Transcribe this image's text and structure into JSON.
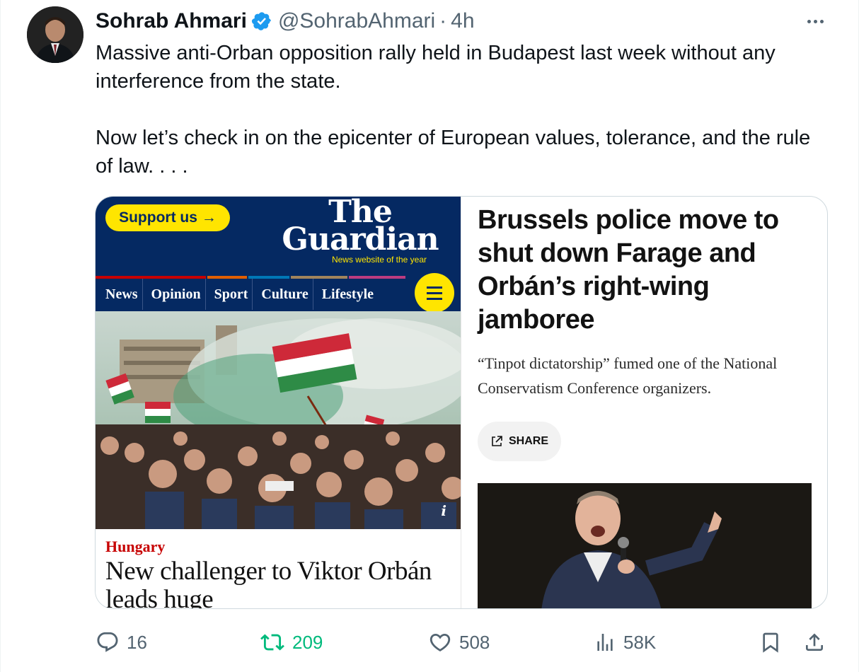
{
  "tweet": {
    "author_name": "Sohrab Ahmari",
    "handle": "@SohrabAhmari",
    "separator": "·",
    "time": "4h",
    "text_para1": "Massive anti-Orban opposition rally held in Budapest last week without any interference from the state.",
    "text_para2": "Now let’s check in on the epicenter of European values, tolerance, and the rule of law. . . ."
  },
  "image_left": {
    "support_label": "Support us",
    "support_arrow": "→",
    "logo_line1": "The",
    "logo_line2": "Guardian",
    "logo_tagline": "News website of the year",
    "nav": [
      "News",
      "Opinion",
      "Sport",
      "Culture",
      "Lifestyle"
    ],
    "photo_info": "i",
    "kicker": "Hungary",
    "headline": "New challenger to Viktor Orbán leads huge"
  },
  "image_right": {
    "headline": "Brussels police move to shut down Farage and Orbán’s right-wing jamboree",
    "standfirst": "“Tinpot dictatorship” fumed one of the National Conservatism Conference organizers.",
    "share_label": "SHARE"
  },
  "actions": {
    "replies": "16",
    "retweets": "209",
    "likes": "508",
    "views": "58K"
  },
  "colors": {
    "text_primary": "#0f1419",
    "text_secondary": "#536471",
    "verified_blue": "#1d9bf0",
    "retweet_green": "#00ba7c",
    "guardian_navy": "#052962",
    "guardian_yellow": "#ffe500",
    "guardian_red": "#c70000"
  }
}
